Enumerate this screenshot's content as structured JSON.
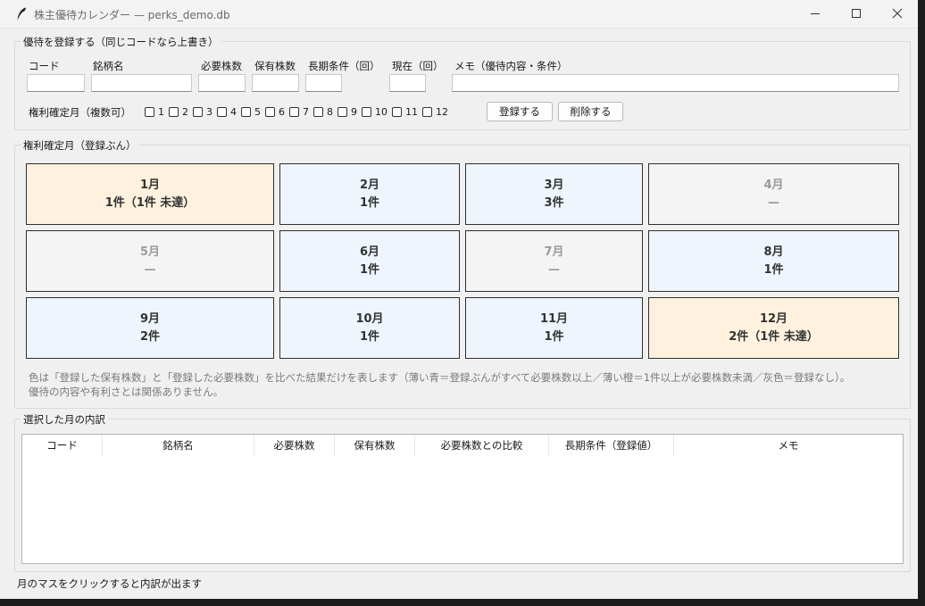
{
  "window": {
    "title": "株主優待カレンダー — perks_demo.db",
    "icon": "feather-icon"
  },
  "form": {
    "group_title": "優待を登録する（同じコードなら上書き）",
    "labels": {
      "code": "コード",
      "name": "銘柄名",
      "required": "必要株数",
      "held": "保有株数",
      "long_term": "長期条件（回）",
      "current": "現在（回）",
      "memo": "メモ（優待内容・条件）"
    },
    "values": {
      "code": "",
      "name": "",
      "required": "",
      "held": "",
      "long_term": "",
      "current": "",
      "memo": ""
    },
    "months_label": "権利確定月（複数可）",
    "month_checks": [
      "1",
      "2",
      "3",
      "4",
      "5",
      "6",
      "7",
      "8",
      "9",
      "10",
      "11",
      "12"
    ],
    "register_button": "登録する",
    "delete_button": "削除する"
  },
  "calendar": {
    "group_title": "権利確定月（登録ぶん）",
    "months": [
      {
        "label": "1月",
        "count": "1件（1件 未達）",
        "status": "warn"
      },
      {
        "label": "2月",
        "count": "1件",
        "status": "ok"
      },
      {
        "label": "3月",
        "count": "3件",
        "status": "ok"
      },
      {
        "label": "4月",
        "count": "—",
        "status": "none"
      },
      {
        "label": "5月",
        "count": "—",
        "status": "none"
      },
      {
        "label": "6月",
        "count": "1件",
        "status": "ok"
      },
      {
        "label": "7月",
        "count": "—",
        "status": "none"
      },
      {
        "label": "8月",
        "count": "1件",
        "status": "ok"
      },
      {
        "label": "9月",
        "count": "2件",
        "status": "ok"
      },
      {
        "label": "10月",
        "count": "1件",
        "status": "ok"
      },
      {
        "label": "11月",
        "count": "1件",
        "status": "ok"
      },
      {
        "label": "12月",
        "count": "2件（1件 未達）",
        "status": "warn"
      }
    ],
    "note_line1": "色は「登録した保有株数」と「登録した必要株数」を比べた結果だけを表します（薄い青＝登録ぶんがすべて必要株数以上／薄い橙＝1件以上が必要株数未満／灰色＝登録なし）。",
    "note_line2": "優待の内容や有利さとは関係ありません。",
    "colors": {
      "ok": "#eef5fd",
      "warn": "#fef1de",
      "none": "#f4f4f4"
    }
  },
  "detail": {
    "group_title": "選択した月の内訳",
    "columns": [
      "コード",
      "銘柄名",
      "必要株数",
      "保有株数",
      "必要株数との比較",
      "長期条件（登録値）",
      "メモ"
    ],
    "rows": []
  },
  "status": "月のマスをクリックすると内訳が出ます"
}
